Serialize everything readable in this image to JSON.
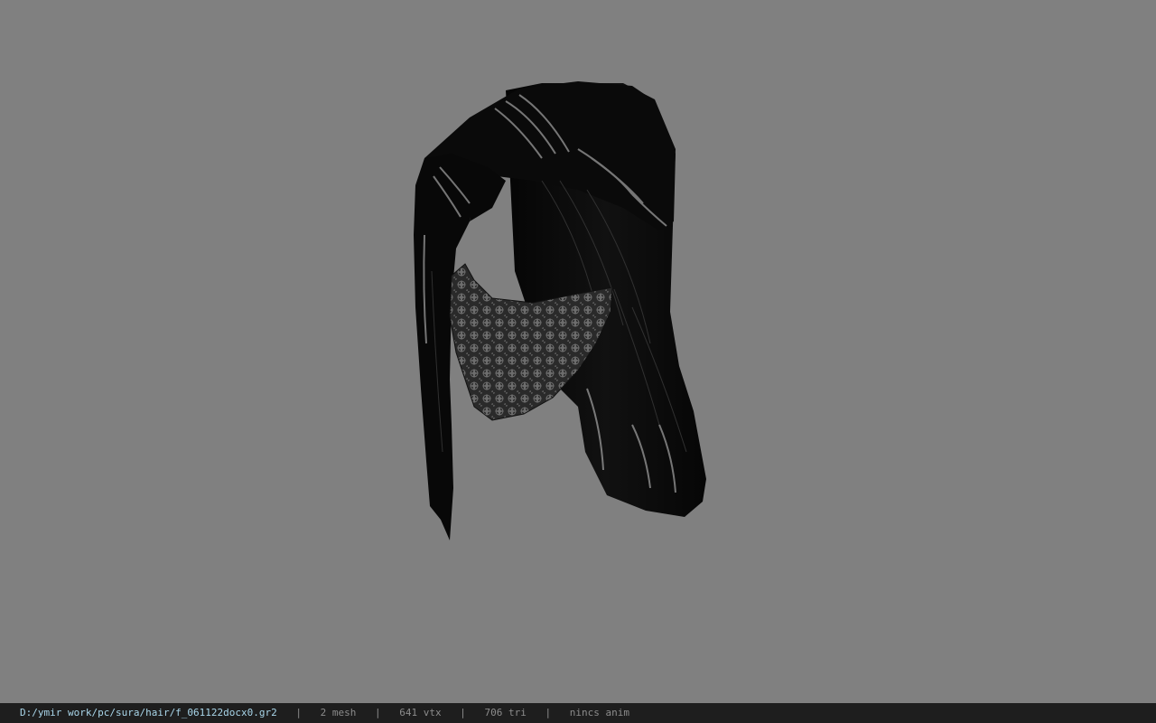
{
  "viewport": {
    "background": "#808080",
    "model_name": "hair-with-mask-model"
  },
  "status_bar": {
    "file_path": "D:/ymir work/pc/sura/hair/f_061122docx0.gr2",
    "separator": "|",
    "mesh_count": "2 mesh",
    "vertex_count": "641 vtx",
    "triangle_count": "706 tri",
    "anim_status": "nincs anim"
  }
}
